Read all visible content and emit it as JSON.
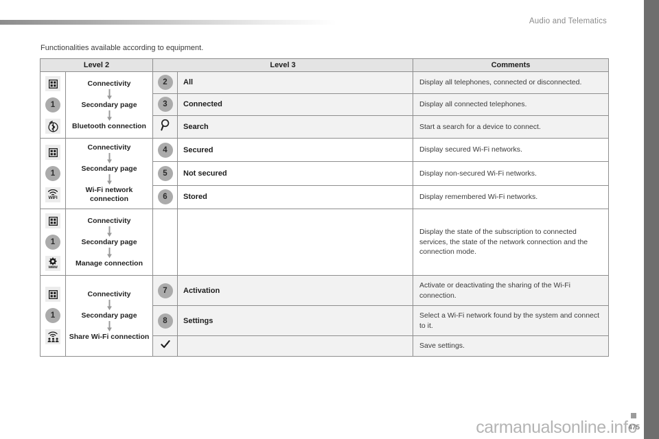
{
  "page": {
    "header_title": "Audio and Telematics",
    "intro": "Functionalities available according to equipment.",
    "folio": "475",
    "watermark": "carmanualsonline.info"
  },
  "table": {
    "headers": {
      "level2": "Level 2",
      "level3": "Level 3",
      "comments": "Comments"
    },
    "sections": [
      {
        "level_number": "1",
        "icons": [
          "grid-icon",
          "level-1-badge",
          "bluetooth-icon"
        ],
        "path": [
          "Connectivity",
          "Secondary page",
          "Bluetooth connection"
        ],
        "rows": [
          {
            "badge": "2",
            "badge_type": "number",
            "label": "All",
            "comment": "Display all telephones, connected or disconnected.",
            "shaded": true
          },
          {
            "badge": "3",
            "badge_type": "number",
            "label": "Connected",
            "comment": "Display all connected telephones.",
            "shaded": true
          },
          {
            "badge": "",
            "badge_type": "search-icon",
            "label": "Search",
            "comment": "Start a search for a device to connect.",
            "shaded": true
          }
        ]
      },
      {
        "level_number": "1",
        "icons": [
          "grid-icon",
          "level-1-badge",
          "wifi-icon"
        ],
        "path": [
          "Connectivity",
          "Secondary page",
          "Wi-Fi network connection"
        ],
        "rows": [
          {
            "badge": "4",
            "badge_type": "number",
            "label": "Secured",
            "comment": "Display secured Wi-Fi networks.",
            "shaded": false
          },
          {
            "badge": "5",
            "badge_type": "number",
            "label": "Not secured",
            "comment": "Display non-secured Wi-Fi networks.",
            "shaded": false
          },
          {
            "badge": "6",
            "badge_type": "number",
            "label": "Stored",
            "comment": "Display remembered Wi-Fi networks.",
            "shaded": false
          }
        ]
      },
      {
        "level_number": "1",
        "icons": [
          "grid-icon",
          "level-1-badge",
          "www-gear-icon"
        ],
        "path": [
          "Connectivity",
          "Secondary page",
          "Manage connection"
        ],
        "rows": [
          {
            "badge": "",
            "badge_type": "none",
            "label": "",
            "comment": "Display the state of the subscription to connected services, the state of the network connection and the connection mode.",
            "shaded": false
          }
        ]
      },
      {
        "level_number": "1",
        "icons": [
          "grid-icon",
          "level-1-badge",
          "share-wifi-icon"
        ],
        "path": [
          "Connectivity",
          "Secondary page",
          "Share Wi-Fi connection"
        ],
        "rows": [
          {
            "badge": "7",
            "badge_type": "number",
            "label": "Activation",
            "comment": "Activate or deactivating the sharing of the Wi-Fi connection.",
            "shaded": true
          },
          {
            "badge": "8",
            "badge_type": "number",
            "label": "Settings",
            "comment": "Select a Wi-Fi network found by the system and connect to it.",
            "shaded": true
          },
          {
            "badge": "",
            "badge_type": "check-icon",
            "label": "",
            "comment": "Save settings.",
            "shaded": true
          }
        ]
      }
    ]
  },
  "colors": {
    "badge_fill": "#ababab",
    "header_fill": "#e4e4e4",
    "shaded_row": "#f2f2f2",
    "border": "#8d8d8d",
    "rail": "#6e6e6e"
  }
}
